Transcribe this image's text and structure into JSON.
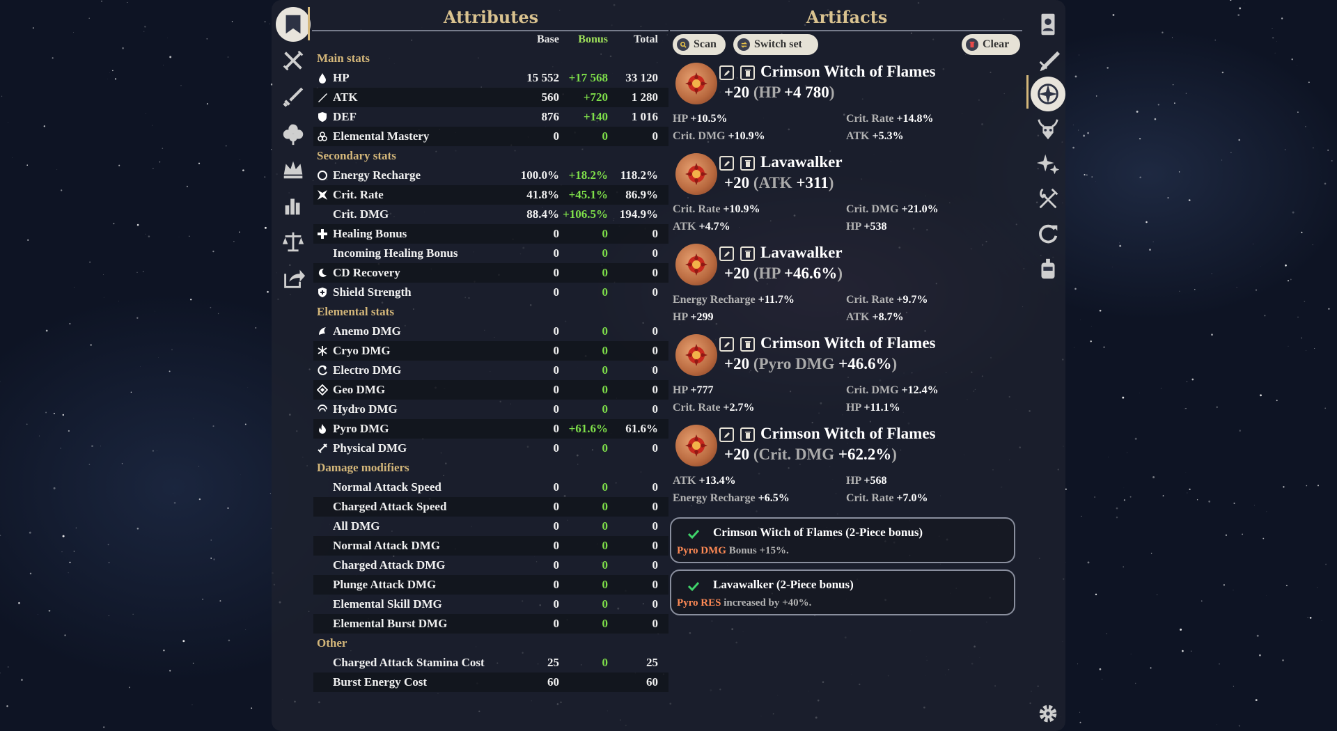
{
  "headers": {
    "attributes": "Attributes",
    "artifacts": "Artifacts"
  },
  "columns": {
    "base": "Base",
    "bonus": "Bonus",
    "total": "Total"
  },
  "colors": {
    "gold": "#d4b77a",
    "bonus_green": "#7fe04a",
    "pyro": "#ff8a55"
  },
  "left_nav": [
    {
      "icon": "book-icon",
      "active": true
    },
    {
      "icon": "crossed-swords-icon"
    },
    {
      "icon": "sword-icon"
    },
    {
      "icon": "flower-icon"
    },
    {
      "icon": "crown-icon"
    },
    {
      "icon": "bar-chart-icon"
    },
    {
      "icon": "scales-icon"
    },
    {
      "icon": "share-icon"
    }
  ],
  "right_nav": [
    {
      "icon": "character-card-icon"
    },
    {
      "icon": "weapon-icon"
    },
    {
      "icon": "compass-star-icon",
      "active": true
    },
    {
      "icon": "horned-helmet-icon"
    },
    {
      "icon": "sparkles-icon"
    },
    {
      "icon": "fork-knife-icon"
    },
    {
      "icon": "refresh-icon"
    },
    {
      "icon": "robot-icon"
    },
    {
      "icon": "settings-gear-icon"
    }
  ],
  "sections": {
    "main": "Main stats",
    "secondary": "Secondary stats",
    "elemental": "Elemental stats",
    "damage": "Damage modifiers",
    "other": "Other"
  },
  "rows": {
    "hp": {
      "name": "HP",
      "base": "15 552",
      "bonus": "+17 568",
      "total": "33 120",
      "icon": "droplet-icon"
    },
    "atk": {
      "name": "ATK",
      "base": "560",
      "bonus": "+720",
      "total": "1 280",
      "icon": "atk-sword-icon"
    },
    "def": {
      "name": "DEF",
      "base": "876",
      "bonus": "+140",
      "total": "1 016",
      "icon": "shield-icon"
    },
    "em": {
      "name": "Elemental Mastery",
      "base": "0",
      "bonus": "0",
      "total": "0",
      "icon": "atom-icon"
    },
    "er": {
      "name": "Energy Recharge",
      "base": "100.0%",
      "bonus": "+18.2%",
      "total": "118.2%",
      "icon": "ring-icon"
    },
    "cr": {
      "name": "Crit. Rate",
      "base": "41.8%",
      "bonus": "+45.1%",
      "total": "86.9%",
      "icon": "crit-star-icon"
    },
    "cd": {
      "name": "Crit. DMG",
      "base": "88.4%",
      "bonus": "+106.5%",
      "total": "194.9%"
    },
    "heal": {
      "name": "Healing Bonus",
      "base": "0",
      "bonus": "0",
      "total": "0",
      "icon": "cross-icon"
    },
    "inheal": {
      "name": "Incoming Healing Bonus",
      "base": "0",
      "bonus": "0",
      "total": "0"
    },
    "cdr": {
      "name": "CD Recovery",
      "base": "0",
      "bonus": "0",
      "total": "0",
      "icon": "moon-icon"
    },
    "shield": {
      "name": "Shield Strength",
      "base": "0",
      "bonus": "0",
      "total": "0",
      "icon": "shield-plus-icon"
    },
    "anemo": {
      "name": "Anemo DMG",
      "base": "0",
      "bonus": "0",
      "total": "0",
      "icon": "anemo-icon"
    },
    "cryo": {
      "name": "Cryo DMG",
      "base": "0",
      "bonus": "0",
      "total": "0",
      "icon": "cryo-icon"
    },
    "electro": {
      "name": "Electro DMG",
      "base": "0",
      "bonus": "0",
      "total": "0",
      "icon": "electro-icon"
    },
    "geo": {
      "name": "Geo DMG",
      "base": "0",
      "bonus": "0",
      "total": "0",
      "icon": "geo-icon"
    },
    "hydro": {
      "name": "Hydro DMG",
      "base": "0",
      "bonus": "0",
      "total": "0",
      "icon": "hydro-icon"
    },
    "pyro": {
      "name": "Pyro DMG",
      "base": "0",
      "bonus": "+61.6%",
      "total": "61.6%",
      "icon": "pyro-icon"
    },
    "phys": {
      "name": "Physical DMG",
      "base": "0",
      "bonus": "0",
      "total": "0",
      "icon": "physical-icon"
    },
    "nas": {
      "name": "Normal Attack Speed",
      "base": "0",
      "bonus": "0",
      "total": "0"
    },
    "cas": {
      "name": "Charged Attack Speed",
      "base": "0",
      "bonus": "0",
      "total": "0"
    },
    "all": {
      "name": "All DMG",
      "base": "0",
      "bonus": "0",
      "total": "0"
    },
    "nad": {
      "name": "Normal Attack DMG",
      "base": "0",
      "bonus": "0",
      "total": "0"
    },
    "cad": {
      "name": "Charged Attack DMG",
      "base": "0",
      "bonus": "0",
      "total": "0"
    },
    "pad": {
      "name": "Plunge Attack DMG",
      "base": "0",
      "bonus": "0",
      "total": "0"
    },
    "esd": {
      "name": "Elemental Skill DMG",
      "base": "0",
      "bonus": "0",
      "total": "0"
    },
    "ebd": {
      "name": "Elemental Burst DMG",
      "base": "0",
      "bonus": "0",
      "total": "0"
    },
    "stam": {
      "name": "Charged Attack Stamina Cost",
      "base": "25",
      "bonus": "0",
      "total": "25"
    },
    "burst": {
      "name": "Burst Energy Cost",
      "base": "60",
      "bonus": "",
      "total": "60"
    }
  },
  "toolbar": {
    "scan": "Scan",
    "switch_set": "Switch set",
    "clear": "Clear"
  },
  "artifacts": [
    {
      "set": "Crimson Witch of Flames",
      "level": "+20",
      "main_stat": "HP",
      "main_value": "+4 780",
      "icon": "flower-artifact-icon",
      "subs": [
        [
          "HP",
          "+10.5%"
        ],
        [
          "Crit. Rate",
          "+14.8%"
        ],
        [
          "Crit. DMG",
          "+10.9%"
        ],
        [
          "ATK",
          "+5.3%"
        ]
      ]
    },
    {
      "set": "Lavawalker",
      "level": "+20",
      "main_stat": "ATK",
      "main_value": "+311",
      "icon": "feather-artifact-icon",
      "subs": [
        [
          "Crit. Rate",
          "+10.9%"
        ],
        [
          "Crit. DMG",
          "+21.0%"
        ],
        [
          "ATK",
          "+4.7%"
        ],
        [
          "HP",
          "+538"
        ]
      ]
    },
    {
      "set": "Lavawalker",
      "level": "+20",
      "main_stat": "HP",
      "main_value": "+46.6%",
      "icon": "sands-artifact-icon",
      "subs": [
        [
          "Energy Recharge",
          "+11.7%"
        ],
        [
          "Crit. Rate",
          "+9.7%"
        ],
        [
          "HP",
          "+299"
        ],
        [
          "ATK",
          "+8.7%"
        ]
      ]
    },
    {
      "set": "Crimson Witch of Flames",
      "level": "+20",
      "main_stat": "Pyro DMG",
      "main_value": "+46.6%",
      "icon": "goblet-artifact-icon",
      "subs": [
        [
          "HP",
          "+777"
        ],
        [
          "Crit. DMG",
          "+12.4%"
        ],
        [
          "Crit. Rate",
          "+2.7%"
        ],
        [
          "HP",
          "+11.1%"
        ]
      ]
    },
    {
      "set": "Crimson Witch of Flames",
      "level": "+20",
      "main_stat": "Crit. DMG",
      "main_value": "+62.2%",
      "icon": "circlet-artifact-icon",
      "subs": [
        [
          "ATK",
          "+13.4%"
        ],
        [
          "HP",
          "+568"
        ],
        [
          "Energy Recharge",
          "+6.5%"
        ],
        [
          "Crit. Rate",
          "+7.0%"
        ]
      ]
    }
  ],
  "set_bonuses": [
    {
      "title": "Crimson Witch of Flames (2-Piece bonus)",
      "highlight": "Pyro DMG",
      "rest": " Bonus +15%."
    },
    {
      "title": "Lavawalker (2-Piece bonus)",
      "highlight": "Pyro RES",
      "rest": " increased by +40%."
    }
  ]
}
